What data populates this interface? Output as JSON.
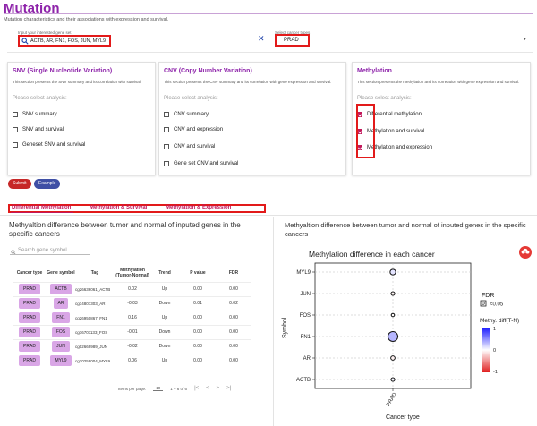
{
  "header": {
    "title": "Mutation",
    "subtitle": "Mutation characteristics and their associations with expression and survival."
  },
  "filters": {
    "gene_label": "Input your interested gene set",
    "gene_value": "ACTB, AR, FN1, FOS, JUN, MYL9",
    "cancer_label": "Select cancer types",
    "cancer_value": "PRAD"
  },
  "cards": {
    "snv": {
      "title": "SNV (Single Nucleotide Variation)",
      "desc": "This section presents the SNV summary and its correlation with survival.",
      "prompt": "Please select analysis:",
      "options": [
        "SNV summary",
        "SNV and survival",
        "Geneset SNV and survival"
      ]
    },
    "cnv": {
      "title": "CNV (Copy Number Variation)",
      "desc": "This section presents the CNV summary and its correlation with gene expression and survival.",
      "prompt": "Please select analysis:",
      "options": [
        "CNV summary",
        "CNV and expression",
        "CNV and survival",
        "Gene set CNV and survival"
      ]
    },
    "methylation": {
      "title": "Methylation",
      "desc": "This section presents the methylation and its correlation with gene expression and survival.",
      "prompt": "Please select analysis:",
      "options": [
        "Differential methylation",
        "Methylation and survival",
        "Methylation and expression"
      ]
    }
  },
  "buttons": {
    "submit": "Submit",
    "example": "Example"
  },
  "tabs": [
    "Differential Methylation",
    "Methylation & Survival",
    "Methylation & Expression"
  ],
  "left_panel": {
    "title": "Methyaltion difference between tumor and normal of inputed genes in the specific cancers",
    "search_placeholder": "Search gene symbol",
    "columns": [
      "Cancer type",
      "Gene symbol",
      "Tag",
      "Methylation (Tumor-Normal)",
      "Trend",
      "P value",
      "FDR"
    ],
    "rows": [
      {
        "cancer": "PRAD",
        "gene": "ACTB",
        "tag": "cg26636061_ACTB",
        "diff": "0.02",
        "trend": "Up",
        "p": "0.00",
        "fdr": "0.00"
      },
      {
        "cancer": "PRAD",
        "gene": "AR",
        "tag": "cg14807303_AR",
        "diff": "-0.03",
        "trend": "Down",
        "p": "0.01",
        "fdr": "0.02"
      },
      {
        "cancer": "PRAD",
        "gene": "FN1",
        "tag": "cg26950867_FN1",
        "diff": "0.16",
        "trend": "Up",
        "p": "0.00",
        "fdr": "0.00"
      },
      {
        "cancer": "PRAD",
        "gene": "FOS",
        "tag": "cg16701133_FOS",
        "diff": "-0.01",
        "trend": "Down",
        "p": "0.00",
        "fdr": "0.00"
      },
      {
        "cancer": "PRAD",
        "gene": "JUN",
        "tag": "cg02669989_JUN",
        "diff": "-0.02",
        "trend": "Down",
        "p": "0.00",
        "fdr": "0.00"
      },
      {
        "cancer": "PRAD",
        "gene": "MYL9",
        "tag": "cg10259004_MYL9",
        "diff": "0.06",
        "trend": "Up",
        "p": "0.00",
        "fdr": "0.00"
      }
    ],
    "pager": {
      "items_label": "Items per page:",
      "items_value": "10",
      "range": "1 – 6 of 6"
    }
  },
  "right_panel": {
    "title": "Methyaltion difference between tumor and normal of inputed genes in the specific cancers"
  },
  "chart_data": {
    "type": "scatter",
    "title": "Methylation difference in each cancer",
    "xlabel": "Cancer type",
    "ylabel": "Symbol",
    "x_categories": [
      "PRAD"
    ],
    "y_categories": [
      "ACTB",
      "AR",
      "FN1",
      "FOS",
      "JUN",
      "MYL9"
    ],
    "points": [
      {
        "x": "PRAD",
        "y": "ACTB",
        "diff": 0.02,
        "fdr": 0.0
      },
      {
        "x": "PRAD",
        "y": "AR",
        "diff": -0.03,
        "fdr": 0.02
      },
      {
        "x": "PRAD",
        "y": "FN1",
        "diff": 0.16,
        "fdr": 0.0
      },
      {
        "x": "PRAD",
        "y": "FOS",
        "diff": -0.01,
        "fdr": 0.0
      },
      {
        "x": "PRAD",
        "y": "JUN",
        "diff": -0.02,
        "fdr": 0.0
      },
      {
        "x": "PRAD",
        "y": "MYL9",
        "diff": 0.06,
        "fdr": 0.0
      }
    ],
    "legend_fdr_title": "FDR",
    "legend_fdr_label": "<0.05",
    "legend_color_title": "Methy. diff(T-N)",
    "color_ticks": [
      "1",
      "0",
      "-1"
    ],
    "colors": {
      "high": "#1a1aff",
      "mid": "#ffffff",
      "low": "#e02020"
    },
    "grid": true,
    "legend_position": "right"
  },
  "colors": {
    "accent": "#8e24aa",
    "tab": "#c2185b",
    "highlight": "#e21a1a"
  }
}
